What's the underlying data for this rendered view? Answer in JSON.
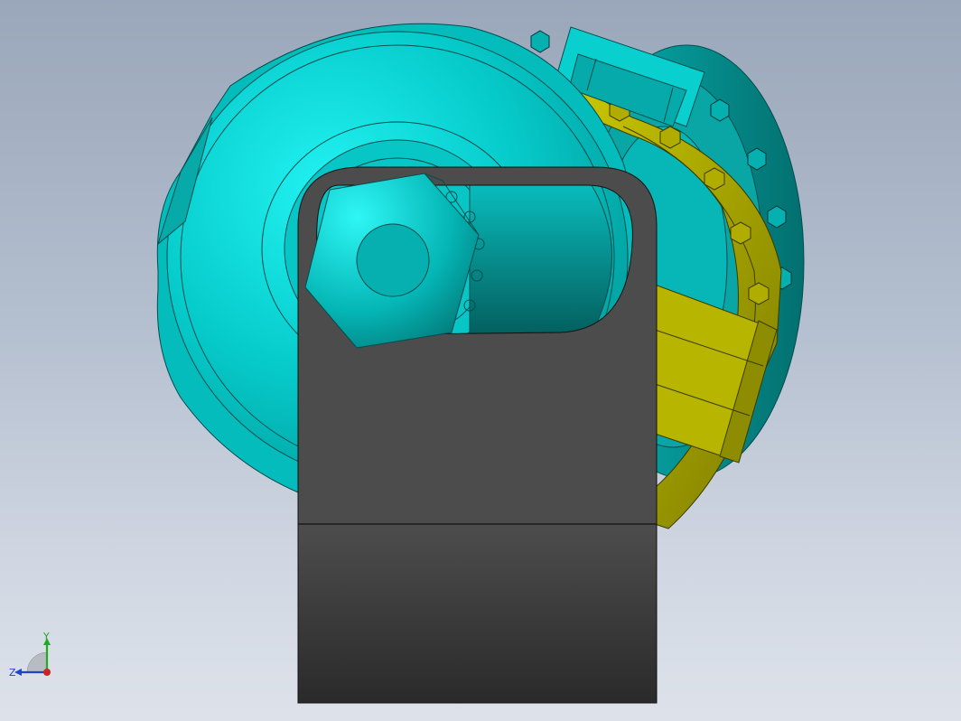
{
  "viewport": {
    "background_top": "#9aa7ba",
    "background_bottom": "#dde2ea"
  },
  "model": {
    "parts": [
      {
        "name": "pulley-wheel",
        "color": "#00d4d4"
      },
      {
        "name": "brake-band",
        "color": "#b5b300"
      },
      {
        "name": "mounting-bracket",
        "color": "#4a4a4a"
      },
      {
        "name": "hex-nut",
        "color": "#00d8d8"
      }
    ]
  },
  "triad": {
    "y_label": "Y",
    "z_label": "Z",
    "y_color": "#22aa22",
    "z_color": "#2244cc",
    "x_color": "#cc2222"
  }
}
